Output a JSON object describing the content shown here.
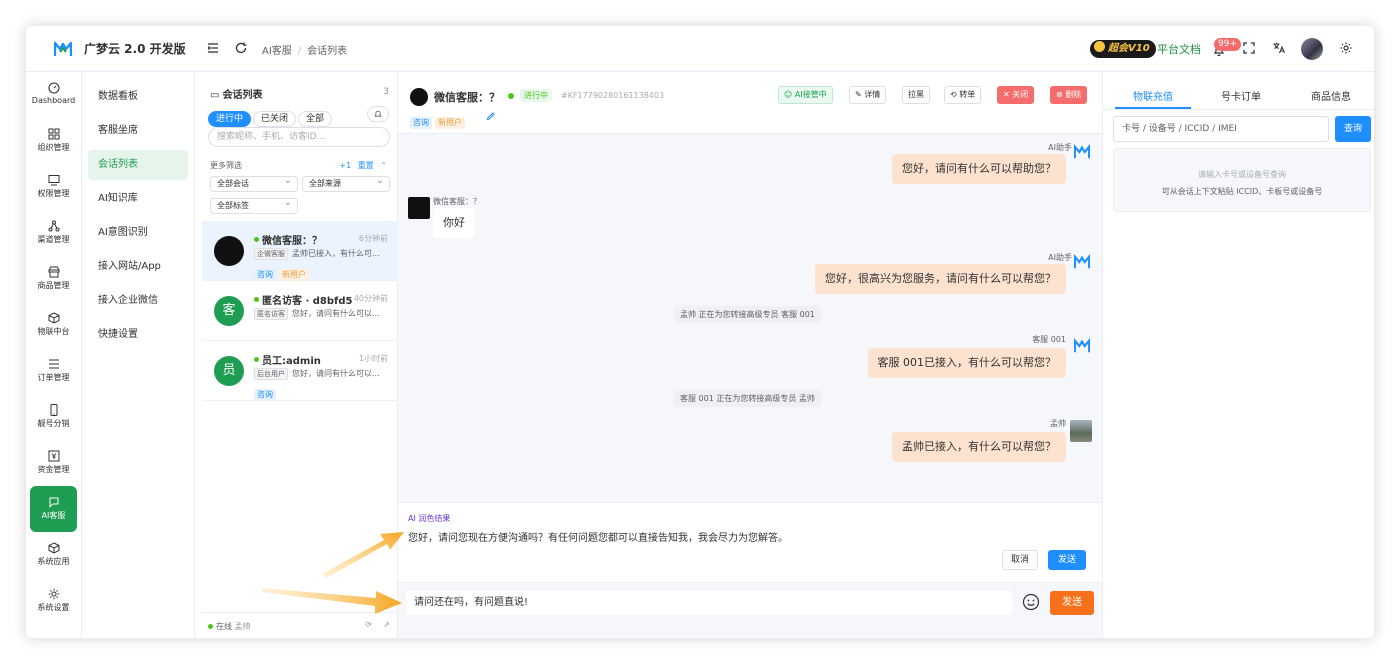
{
  "app": {
    "name": "广梦云 2.0 开发版",
    "brand_color": "#1f8fff",
    "accent_green": "#1f9d52"
  },
  "header": {
    "breadcrumb": [
      "AI客服",
      "会话列表"
    ],
    "vip_label": "超会V10",
    "docs_link": "平台文档",
    "notification_badge": "99+",
    "icons": [
      "menu-fold-icon",
      "refresh-icon",
      "bell-icon",
      "fullscreen-icon",
      "translate-icon",
      "avatar",
      "gear-icon"
    ]
  },
  "nav": {
    "items": [
      {
        "label": "Dashboard",
        "icon": "dashboard-icon"
      },
      {
        "label": "组织管理",
        "icon": "grid-icon"
      },
      {
        "label": "权限管理",
        "icon": "monitor-icon"
      },
      {
        "label": "渠道管理",
        "icon": "share-icon"
      },
      {
        "label": "商品管理",
        "icon": "store-icon"
      },
      {
        "label": "物联中台",
        "icon": "cube-icon"
      },
      {
        "label": "订单管理",
        "icon": "list-icon"
      },
      {
        "label": "靓号分销",
        "icon": "phone-icon"
      },
      {
        "label": "资金管理",
        "icon": "money-icon"
      },
      {
        "label": "AI客服",
        "icon": "chat-icon",
        "active": true
      },
      {
        "label": "系统应用",
        "icon": "box-icon"
      },
      {
        "label": "系统设置",
        "icon": "gear-icon"
      }
    ]
  },
  "subnav": {
    "items": [
      {
        "label": "数据看板"
      },
      {
        "label": "客服坐席"
      },
      {
        "label": "会话列表",
        "active": true
      },
      {
        "label": "AI知识库"
      },
      {
        "label": "AI意图识别"
      },
      {
        "label": "接入网站/App"
      },
      {
        "label": "接入企业微信"
      },
      {
        "label": "快捷设置"
      }
    ]
  },
  "conv_panel": {
    "title": "会话列表",
    "count": "3",
    "tabs": [
      "进行中",
      "已关闭",
      "全部"
    ],
    "search_placeholder": "搜索昵称、手机、访客ID...",
    "more_filters": "更多筛选",
    "filter_count": "+1",
    "reset": "重置",
    "filters": [
      "全部会话",
      "全部来源",
      "全部标签"
    ],
    "items": [
      {
        "avatar": "",
        "name": "微信客服：？",
        "time": "6分钟前",
        "source": "企微客服",
        "preview": "孟帅已接入，有什么可...",
        "tags": [
          "咨询",
          "新用户"
        ]
      },
      {
        "avatar": "客",
        "name": "匿名访客 · d8bfd5",
        "time": "40分钟前",
        "source": "匿名访客",
        "preview": "您好，请问有什么可以...",
        "tags": []
      },
      {
        "avatar": "员",
        "name": "员工:admin",
        "time": "1小时前",
        "source": "后台用户",
        "preview": "您好，请问有什么可以...",
        "tags": [
          "咨询"
        ]
      }
    ],
    "footer_status": "在线",
    "footer_user": "孟帅"
  },
  "chat": {
    "contact_name": "微信客服：？",
    "status": "进行中",
    "session_id": "#KF17790280161138403",
    "tags": [
      "咨询",
      "新用户"
    ],
    "actions": [
      "AI接管中",
      "详情",
      "拉黑",
      "转单",
      "关闭",
      "删除"
    ],
    "messages": [
      {
        "sender": "AI助手",
        "text": "您好，请问有什么可以帮助您？"
      },
      {
        "sender": "微信客服：？",
        "text": "你好"
      },
      {
        "sender": "AI助手",
        "text": "您好，很高兴为您服务，请问有什么可以帮您？"
      },
      {
        "system": "孟帅 正在为您转接高级专员 客服 001"
      },
      {
        "sender": "客服 001",
        "text": "客服 001已接入，有什么可以帮您？"
      },
      {
        "system": "客服 001 正在为您转接高级专员 孟帅"
      },
      {
        "sender": "孟帅",
        "text": "孟帅已接入，有什么可以帮您？"
      }
    ],
    "ai_result": {
      "title": "AI 润色结果",
      "text": "您好，请问您现在方便沟通吗？有任何问题您都可以直接告知我，我会尽力为您解答。",
      "cancel": "取消",
      "send": "发送"
    },
    "input_value": "请问还在吗，有问题直说!",
    "send": "发送"
  },
  "right_panel": {
    "tabs": [
      "物联充值",
      "号卡订单",
      "商品信息"
    ],
    "input_placeholder": "卡号 / 设备号 / ICCID / IMEI",
    "query_button": "查询",
    "empty_title": "请输入卡号或设备号查询",
    "empty_hint": "可从会话上下文粘贴 ICCID、卡板号或设备号"
  }
}
